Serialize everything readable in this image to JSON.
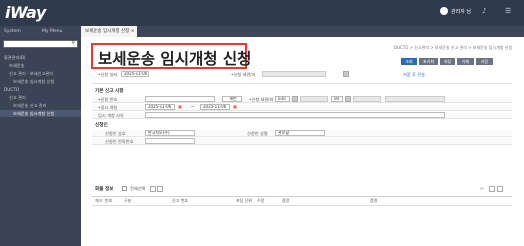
{
  "app": {
    "logo": "iWay",
    "user": "관리자 님"
  },
  "menu_tabs": [
    {
      "label": "System Menu"
    },
    {
      "label": "My Menu"
    },
    {
      "label": "보세운송 임시개청 신청 ×"
    }
  ],
  "sidebar": {
    "items": [
      {
        "label": "통관관리(B)"
      },
      {
        "label": "보세운송"
      },
      {
        "label": "신고 관리 - 보세신고관리"
      },
      {
        "label": "보세운송 임시개청 신청"
      },
      {
        "label": "DUCTO"
      },
      {
        "label": "신고 관리"
      },
      {
        "label": "보세운송 신고 관리"
      },
      {
        "label": "보세운송 임시개청 신청"
      }
    ]
  },
  "page": {
    "title": "보세운송 임시개청 신청",
    "breadcrumb": "DUCTO > 신고관리 > 보세운송 신고 관리 > 보세운송 임시개청 신청",
    "buttons": [
      "조회",
      "초기화",
      "저장",
      "삭제",
      "저장"
    ],
    "filter": {
      "req_date_label": "•신청 일자",
      "req_date": "2025-11-06",
      "user_label": "•신청 세관/과",
      "save_label": "저장 후 전송"
    }
  },
  "base": {
    "section": "기본 신고 사항",
    "req_no_label": "•신청 번호",
    "new_btn": "채번",
    "office_label": "•신청 세관/과",
    "office_code": "030",
    "office_dept": "00",
    "transport_label": "•일시 개청",
    "from_date": "2025-11-06",
    "to_date": "2025-11-06",
    "reason_label": "임시 개청 사유"
  },
  "applicant": {
    "section": "신청인",
    "company_label": "신청인 상호",
    "company_value": "한국지오(주)",
    "name_label": "신청인 성명",
    "name_value": "관로할",
    "bizno_label": "신청인 전화번호"
  },
  "cargo": {
    "section": "화물 정보",
    "select_label": "전체선택",
    "columns": [
      "체크",
      "번호",
      "구분",
      "신고 번호",
      "포장 단위",
      "수량",
      "중량",
      "품명"
    ]
  }
}
